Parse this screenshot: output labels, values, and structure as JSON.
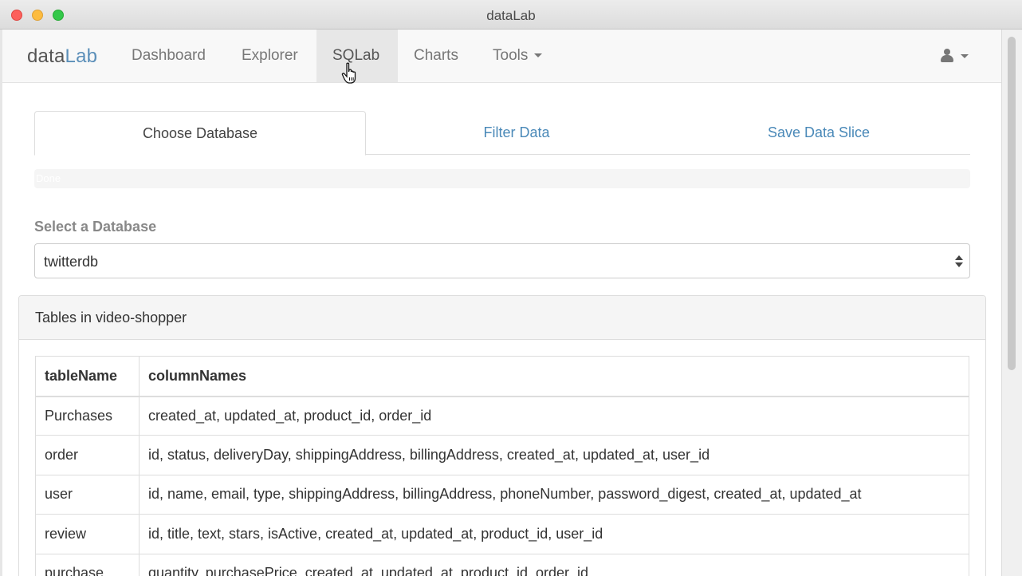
{
  "window": {
    "title": "dataLab"
  },
  "navbar": {
    "brand_part1": "data",
    "brand_part2": "Lab",
    "items": [
      {
        "label": "Dashboard"
      },
      {
        "label": "Explorer"
      },
      {
        "label": "SQLab"
      },
      {
        "label": "Charts"
      },
      {
        "label": "Tools"
      }
    ],
    "active_item": "SQLab"
  },
  "tabs": [
    {
      "label": "Choose Database"
    },
    {
      "label": "Filter Data"
    },
    {
      "label": "Save Data Slice"
    }
  ],
  "progress": {
    "text": "Done"
  },
  "form": {
    "label": "Select a Database",
    "selected": "twitterdb"
  },
  "panel": {
    "title": "Tables in video-shopper",
    "columns": [
      "tableName",
      "columnNames"
    ],
    "rows": [
      {
        "table": "Purchases",
        "columns": "created_at, updated_at, product_id, order_id"
      },
      {
        "table": "order",
        "columns": "id, status, deliveryDay, shippingAddress, billingAddress, created_at, updated_at, user_id"
      },
      {
        "table": "user",
        "columns": "id, name, email, type, shippingAddress, billingAddress, phoneNumber, password_digest, created_at, updated_at"
      },
      {
        "table": "review",
        "columns": "id, title, text, stars, isActive, created_at, updated_at, product_id, user_id"
      },
      {
        "table": "purchase",
        "columns": "quantity, purchasePrice, created_at, updated_at, product_id, order_id"
      }
    ]
  },
  "colors": {
    "link": "#4a89b8",
    "brand_accent": "#5b8fb9",
    "navbar_bg": "#f8f8f8"
  },
  "icons": {
    "user": "user-icon",
    "cursor": "pointer-hand-cursor"
  }
}
